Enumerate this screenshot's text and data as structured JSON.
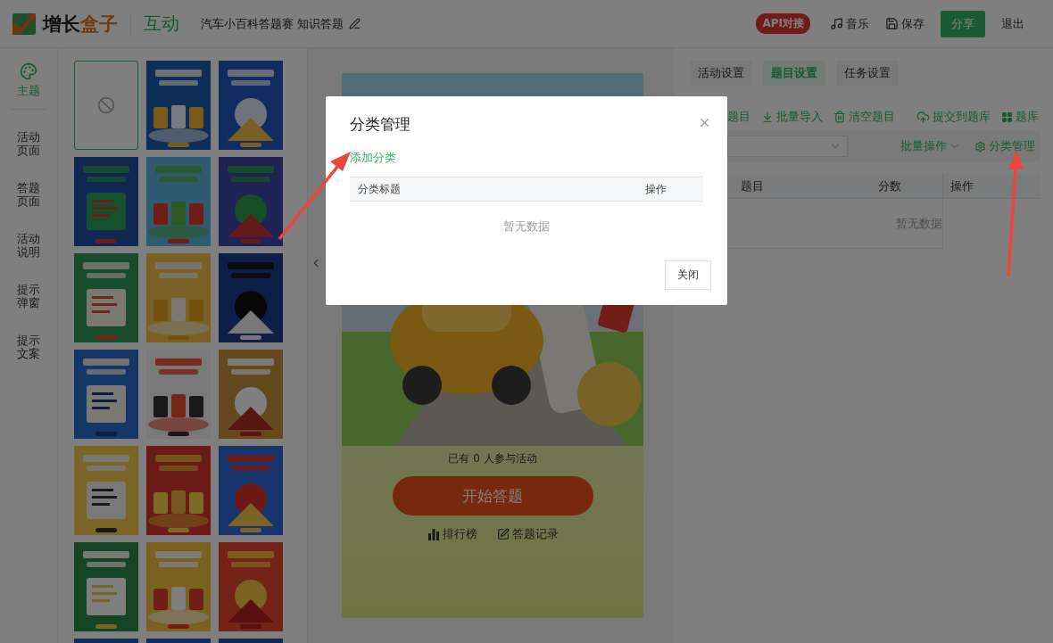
{
  "header": {
    "brand": [
      {
        "text": "增长",
        "kind": "dark"
      },
      {
        "text": "盒子",
        "kind": "accent"
      }
    ],
    "section": "互动",
    "title": "汽车小百科答题赛 知识答题",
    "badge": "API对接",
    "actions": [
      {
        "kind": "music",
        "label": "音乐"
      },
      {
        "kind": "save",
        "label": "保存"
      },
      {
        "kind": "primary",
        "label": "分享"
      },
      {
        "kind": "plain",
        "label": "退出"
      }
    ]
  },
  "sidebar": {
    "items": [
      {
        "label": "主题",
        "selected": true
      },
      {
        "label": "活动页面",
        "selected": false
      },
      {
        "label": "答题页面",
        "selected": false
      },
      {
        "label": "活动说明",
        "selected": false
      },
      {
        "label": "提示弹窗",
        "selected": false
      },
      {
        "label": "提示文案",
        "selected": false
      }
    ]
  },
  "themes": [
    {
      "kind": "none",
      "selected": true
    },
    {
      "kind": "picture",
      "selected": false
    },
    {
      "kind": "picture",
      "selected": false
    },
    {
      "kind": "picture",
      "selected": false
    },
    {
      "kind": "picture",
      "selected": false
    },
    {
      "kind": "picture",
      "selected": false
    },
    {
      "kind": "picture",
      "selected": false
    },
    {
      "kind": "picture",
      "selected": false
    },
    {
      "kind": "picture",
      "selected": false
    },
    {
      "kind": "picture",
      "selected": false
    },
    {
      "kind": "picture",
      "selected": false
    },
    {
      "kind": "picture",
      "selected": false
    },
    {
      "kind": "picture",
      "selected": false
    },
    {
      "kind": "picture",
      "selected": false
    },
    {
      "kind": "picture",
      "selected": false
    },
    {
      "kind": "picture",
      "selected": false
    },
    {
      "kind": "picture",
      "selected": false
    },
    {
      "kind": "picture",
      "selected": false
    },
    {
      "kind": "picture",
      "selected": false
    },
    {
      "kind": "picture",
      "selected": false
    },
    {
      "kind": "picture",
      "selected": false
    }
  ],
  "preview": {
    "participants": "已有 0 人参与活动",
    "start_button": "开始答题",
    "links": [
      {
        "kind": "ranking",
        "label": "排行榜"
      },
      {
        "kind": "records",
        "label": "答题记录"
      }
    ]
  },
  "settings": {
    "tabs": [
      {
        "label": "活动设置",
        "selected": false
      },
      {
        "label": "题目设置",
        "selected": true
      },
      {
        "label": "任务设置",
        "selected": false
      }
    ],
    "toolbar": [
      {
        "kind": "plain",
        "label": "题目"
      },
      {
        "kind": "import",
        "label": "批量导入"
      },
      {
        "kind": "clear",
        "label": "清空题目"
      },
      {
        "kind": "submit",
        "label": "提交到题库"
      },
      {
        "kind": "bank",
        "label": "题库"
      }
    ],
    "batch": "批量操作",
    "category": "分类管理",
    "columns": [
      "题目",
      "分数",
      "操作"
    ],
    "empty": "暂无数据"
  },
  "dialog": {
    "title": "分类管理",
    "add_link": "添加分类",
    "columns": [
      "分类标题",
      "操作"
    ],
    "empty": "暂无数据",
    "close_button": "关闭"
  },
  "annotations": [
    {
      "kind": "arrow"
    },
    {
      "kind": "arrow"
    }
  ]
}
